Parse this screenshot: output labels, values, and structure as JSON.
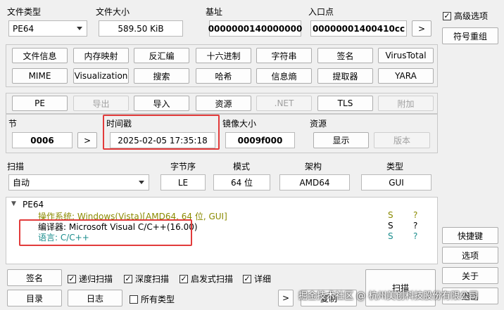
{
  "top": {
    "file_type_label": "文件类型",
    "file_type_value": "PE64",
    "file_size_label": "文件大小",
    "file_size_value": "589.50 KiB",
    "base_label": "基址",
    "base_value": "0000000140000000",
    "entry_label": "入口点",
    "entry_value": "00000001400410cc",
    "entry_more": ">",
    "advanced_label": "高级选项",
    "advanced_checked": "✓",
    "symbol_btn": "符号重组"
  },
  "tools_row1": [
    "文件信息",
    "内存映射",
    "反汇编",
    "十六进制",
    "字符串",
    "签名",
    "VirusTotal"
  ],
  "tools_row2": [
    "MIME",
    "Visualization",
    "搜索",
    "哈希",
    "信息熵",
    "提取器",
    "YARA"
  ],
  "pe_row": [
    "PE",
    "导出",
    "导入",
    "资源",
    ".NET",
    "TLS",
    "附加"
  ],
  "section": {
    "label": "节",
    "value": "0006",
    "more": ">"
  },
  "timestamp": {
    "label": "时间戳",
    "value": "2025-02-05 17:35:18"
  },
  "image_size": {
    "label": "镜像大小",
    "value": "0009f000"
  },
  "resources": {
    "label": "资源",
    "show_btn": "显示",
    "version_btn": "版本"
  },
  "scan_row": {
    "scan_label": "扫描",
    "scan_value": "自动",
    "endian_label": "字节序",
    "endian_value": "LE",
    "mode_label": "模式",
    "mode_value": "64 位",
    "arch_label": "架构",
    "arch_value": "AMD64",
    "type_label": "类型",
    "type_value": "GUI"
  },
  "tree": {
    "expander": "▼",
    "root": "PE64",
    "rows": [
      {
        "text": "操作系统: Windows(Vista)[AMD64, 64 位, GUI]",
        "s": "S",
        "q": "?",
        "color": "#8a8a00"
      },
      {
        "text": "编译器: Microsoft Visual C/C++(16.00)",
        "s": "S",
        "q": "?",
        "color": "#000000"
      },
      {
        "text": "语言: C/C++",
        "s": "S",
        "q": "?",
        "color": "#1a8c8c"
      }
    ]
  },
  "right_side": {
    "shortcuts": "快捷键",
    "options": "选项",
    "about": "关于",
    "exit": "退出"
  },
  "bottom": {
    "signature_btn": "签名",
    "recursive_label": "递归扫描",
    "recursive_check": "✓",
    "deep_label": "深度扫描",
    "deep_check": "✓",
    "heuristic_label": "启发式扫描",
    "heuristic_check": "✓",
    "verbose_label": "详细",
    "verbose_check": "✓",
    "dir_btn": "目录",
    "log_btn": "日志",
    "all_types_label": "所有类型",
    "more_btn": ">",
    "scan_btn": "扫描",
    "extra_btn": "复制"
  },
  "watermark": "掘金技术社区 @ 杭州美创科技股份有限公司",
  "colors": {
    "highlight_red": "#e23b3b",
    "os_text": "#8a8a00",
    "lang_text": "#1a8c8c"
  }
}
